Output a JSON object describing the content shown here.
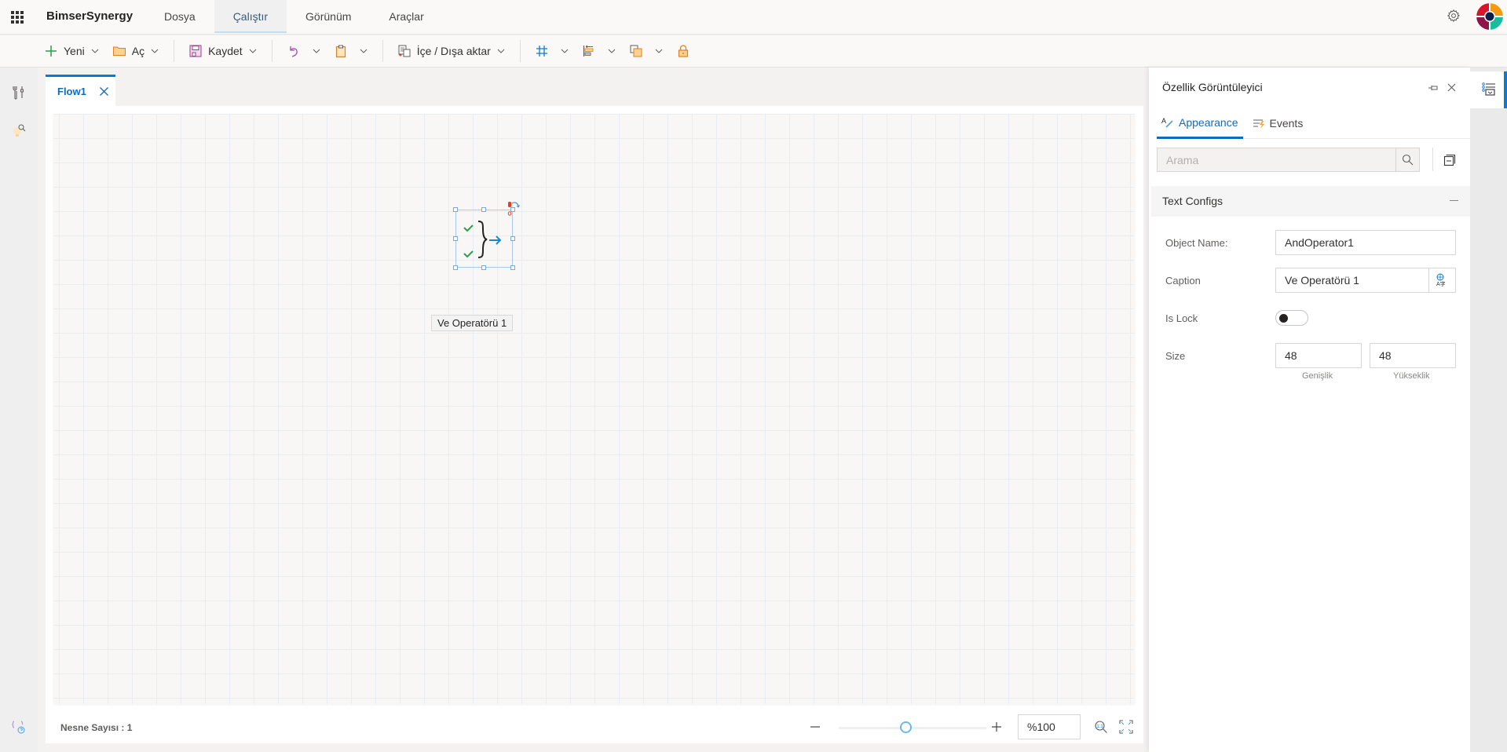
{
  "app": {
    "brand": "BimserSynergy",
    "menu": [
      {
        "label": "Dosya",
        "active": false
      },
      {
        "label": "Çalıştır",
        "active": true
      },
      {
        "label": "Görünüm",
        "active": false
      },
      {
        "label": "Araçlar",
        "active": false
      }
    ],
    "icons": {
      "launcher": "waffle-icon",
      "settings": "gear-icon",
      "profile": "avatar"
    }
  },
  "toolbar": {
    "new_label": "Yeni",
    "open_label": "Aç",
    "save_label": "Kaydet",
    "import_export_label": "İçe / Dışa aktar",
    "icons": [
      "plus-icon",
      "folder-icon",
      "save-icon",
      "undo-icon",
      "clipboard-icon",
      "import-export-icon",
      "grid-icon",
      "align-icon",
      "arrange-icon",
      "lock-icon"
    ]
  },
  "left_rail": {
    "icons": [
      "toolbox-icon",
      "search-bulb-icon",
      "variables-help-icon"
    ]
  },
  "editor": {
    "tabs": [
      {
        "label": "Flow1",
        "active": true
      }
    ],
    "node": {
      "caption": "Ve Operatörü 1",
      "type": "and-operator"
    },
    "status": {
      "object_count_label": "Nesne Sayısı : 1",
      "zoom_value": "%100",
      "zoom_slider_fraction": 0.5
    }
  },
  "properties": {
    "title": "Özellik Görüntüleyici",
    "tabs": [
      {
        "label": "Appearance",
        "active": true
      },
      {
        "label": "Events",
        "active": false
      }
    ],
    "search_placeholder": "Arama",
    "section": {
      "title": "Text Configs",
      "expanded": true
    },
    "fields": {
      "object_name_label": "Object Name:",
      "object_name_value": "AndOperator1",
      "caption_label": "Caption",
      "caption_value": "Ve Operatörü 1",
      "is_lock_label": "Is Lock",
      "is_lock_value": false,
      "size_label": "Size",
      "width_value": "48",
      "height_value": "48",
      "width_sublabel": "Genişlik",
      "height_sublabel": "Yükseklik"
    }
  },
  "colors": {
    "accent": "#0f78d4",
    "check_green": "#2e9e4f",
    "arrow_blue": "#1a86d0",
    "grid_line": "#e6edf6"
  }
}
